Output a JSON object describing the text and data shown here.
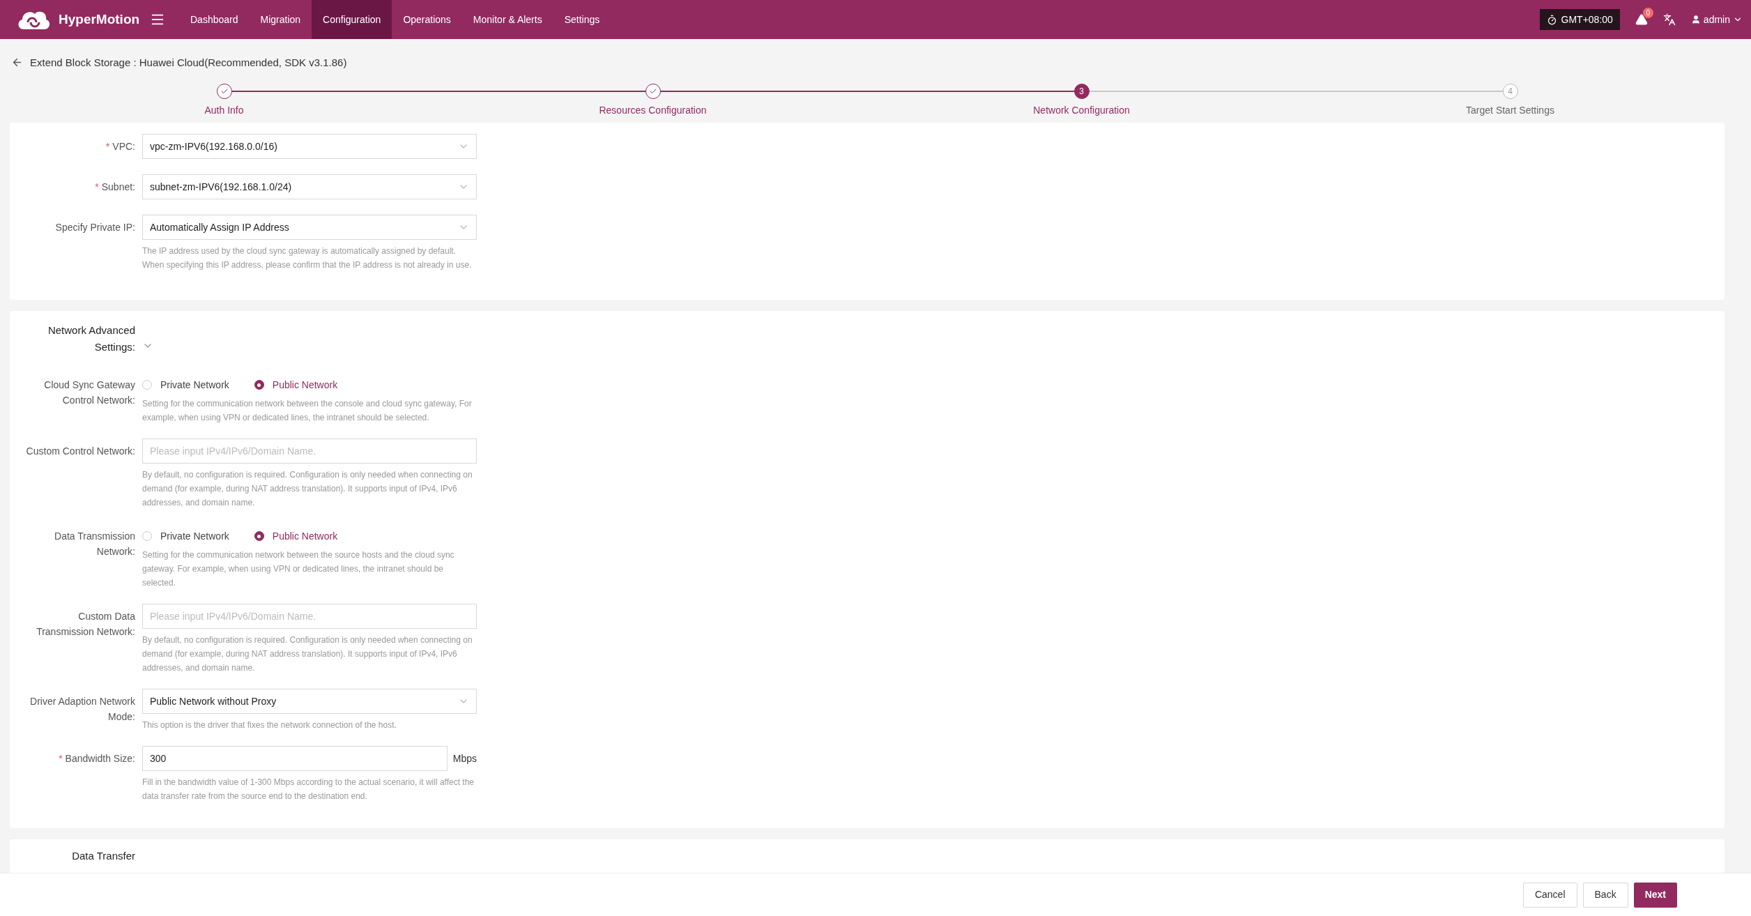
{
  "header": {
    "brand": "HyperMotion",
    "nav": [
      {
        "label": "Dashboard",
        "selected": false
      },
      {
        "label": "Migration",
        "selected": false
      },
      {
        "label": "Configuration",
        "selected": true
      },
      {
        "label": "Operations",
        "selected": false
      },
      {
        "label": "Monitor & Alerts",
        "selected": false
      },
      {
        "label": "Settings",
        "selected": false
      }
    ],
    "timezone": "GMT+08:00",
    "alert_count": "0",
    "user": "admin"
  },
  "page_title": "Extend Block Storage : Huawei Cloud(Recommended, SDK v3.1.86)",
  "steps": [
    {
      "label": "Auth Info",
      "completed": true,
      "selected": false
    },
    {
      "label": "Resources Configuration",
      "completed": true,
      "selected": false
    },
    {
      "number": "3",
      "label": "Network Configuration",
      "completed": false,
      "selected": true
    },
    {
      "number": "4",
      "label": "Target Start Settings",
      "completed": false,
      "selected": false
    }
  ],
  "sections": [
    {
      "fields": [
        {
          "kind": "select",
          "label": "VPC:",
          "required_mark": "*",
          "value": "vpc-zm-IPV6(192.168.0.0/16)"
        },
        {
          "kind": "select",
          "label": "Subnet:",
          "required_mark": "*",
          "value": "subnet-zm-IPV6(192.168.1.0/24)"
        },
        {
          "kind": "select",
          "label": "Specify Private IP:",
          "value": "Automatically Assign IP Address",
          "help": "The IP address used by the cloud sync gateway is automatically assigned by default. When specifying this IP address, please confirm that the IP address is not already in use."
        }
      ]
    },
    {
      "title": "Network Advanced Settings:",
      "expanded": true,
      "fields": [
        {
          "kind": "radio",
          "label": "Cloud Sync Gateway Control Network:",
          "options": [
            {
              "label": "Private Network",
              "selected": false
            },
            {
              "label": "Public Network",
              "selected": true
            }
          ],
          "help": "Setting for the communication network between the console and cloud sync gateway, For example, when using VPN or dedicated lines, the intranet should be selected."
        },
        {
          "kind": "input",
          "label": "Custom Control Network:",
          "placeholder": "Please input IPv4/IPv6/Domain Name.",
          "help": "By default, no configuration is required. Configuration is only needed when connecting on demand (for example, during NAT address translation). It supports input of IPv4, IPv6 addresses, and domain name."
        },
        {
          "kind": "radio",
          "label": "Data Transmission Network:",
          "options": [
            {
              "label": "Private Network",
              "selected": false
            },
            {
              "label": "Public Network",
              "selected": true
            }
          ],
          "help": "Setting for the communication network between the source hosts and the cloud sync gateway. For example, when using VPN or dedicated lines, the intranet should be selected."
        },
        {
          "kind": "input",
          "label": "Custom Data Transmission Network:",
          "placeholder": "Please input IPv4/IPv6/Domain Name.",
          "help": "By default, no configuration is required. Configuration is only needed when connecting on demand (for example, during NAT address translation). It supports input of IPv4, IPv6 addresses, and domain name."
        },
        {
          "kind": "select",
          "label": "Driver Adaption Network Mode:",
          "value": "Public Network without Proxy",
          "help": "This option is the driver that fixes the network connection of the host."
        },
        {
          "kind": "input",
          "label": "Bandwidth Size:",
          "required_mark": "*",
          "value": "300",
          "unit": "Mbps",
          "help": "Fill in the bandwidth value of 1-300 Mbps according to the actual scenario, it will affect the data transfer rate from the source end to the destination end."
        }
      ]
    },
    {
      "title": "Data Transfer"
    }
  ],
  "footer": {
    "buttons": [
      {
        "label": "Cancel",
        "kind": "default"
      },
      {
        "label": "Back",
        "kind": "default"
      },
      {
        "label": "Next",
        "kind": "primary"
      }
    ]
  }
}
